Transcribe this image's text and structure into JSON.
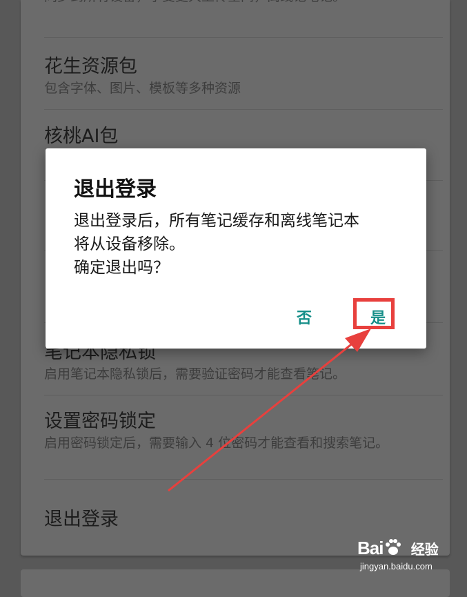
{
  "settings": {
    "items": [
      {
        "title": "",
        "subtitle": "同步到所有设备，享受更大上传空间，离线记笔记。"
      },
      {
        "title": "花生资源包",
        "subtitle": "包含字体、图片、模板等多种资源"
      },
      {
        "title": "核桃AI包",
        "subtitle": ""
      },
      {
        "title": "笔记本隐私锁",
        "subtitle": "启用笔记本隐私锁后，需要验证密码才能查看笔记。"
      },
      {
        "title": "设置密码锁定",
        "subtitle": "启用密码锁定后，需要输入 4 位密码才能查看和搜索笔记。"
      },
      {
        "title": "退出登录",
        "subtitle": ""
      }
    ]
  },
  "dialog": {
    "title": "退出登录",
    "message_lines": [
      "退出登录后，所有笔记缓存和离线笔记本",
      "将从设备移除。",
      "确定退出吗？"
    ],
    "cancel_label": "否",
    "confirm_label": "是"
  },
  "watermark": {
    "logo_left": "Bai",
    "logo_right": "",
    "label": "经验",
    "url": "jingyan.baidu.com"
  },
  "colors": {
    "accent": "#168f89",
    "highlight": "#e8403d",
    "overlay_bg": "#585858",
    "card_bg": "#6b6b6b"
  }
}
